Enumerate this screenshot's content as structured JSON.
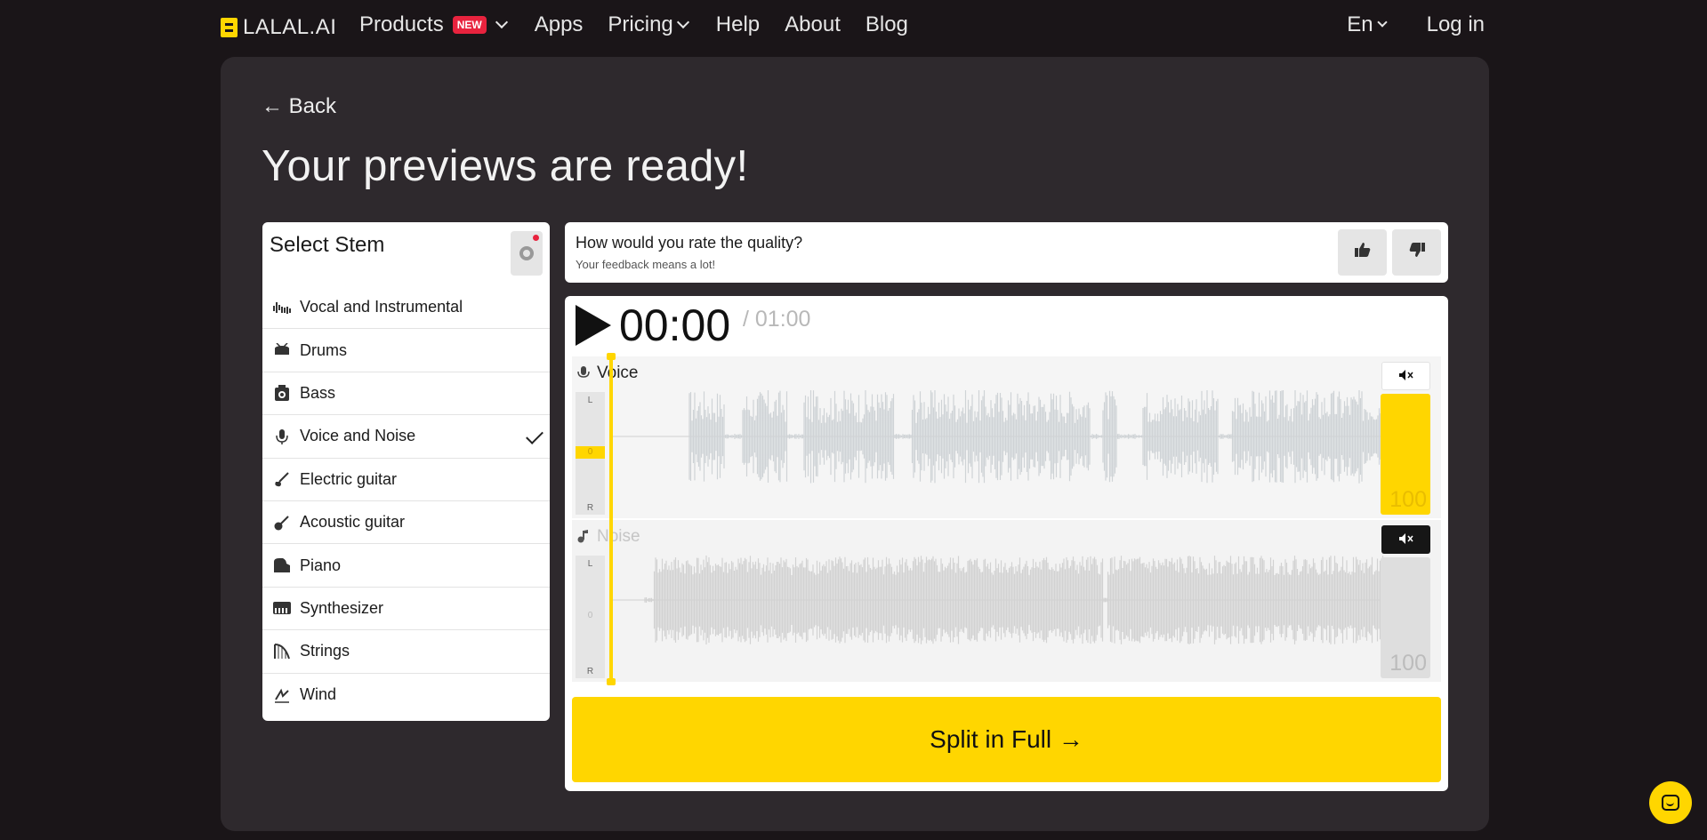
{
  "header": {
    "logo_text": "LALAL.AI",
    "nav": {
      "products": "Products",
      "products_badge": "NEW",
      "apps": "Apps",
      "pricing": "Pricing",
      "help": "Help",
      "about": "About",
      "blog": "Blog"
    },
    "language": "En",
    "login": "Log in"
  },
  "page": {
    "back_label": "← Back",
    "title": "Your previews are ready!"
  },
  "stems": {
    "heading": "Select Stem",
    "items": [
      {
        "label": "Vocal and Instrumental",
        "icon": "waveform-icon"
      },
      {
        "label": "Drums",
        "icon": "drum-icon"
      },
      {
        "label": "Bass",
        "icon": "bass-amp-icon"
      },
      {
        "label": "Voice and Noise",
        "icon": "microphone-icon",
        "selected": true
      },
      {
        "label": "Electric guitar",
        "icon": "electric-guitar-icon"
      },
      {
        "label": "Acoustic guitar",
        "icon": "acoustic-guitar-icon"
      },
      {
        "label": "Piano",
        "icon": "piano-icon"
      },
      {
        "label": "Synthesizer",
        "icon": "synthesizer-icon"
      },
      {
        "label": "Strings",
        "icon": "harp-icon"
      },
      {
        "label": "Wind",
        "icon": "wind-icon"
      }
    ]
  },
  "feedback": {
    "question": "How would you rate the quality?",
    "subtitle": "Your feedback means a lot!"
  },
  "player": {
    "current_time": "00:00",
    "total_time": "/ 01:00",
    "tracks": [
      {
        "name": "Voice",
        "pan_left": "L",
        "pan_mid": "0",
        "pan_right": "R",
        "volume": "100",
        "muted": false
      },
      {
        "name": "Noise",
        "pan_left": "L",
        "pan_mid": "0",
        "pan_right": "R",
        "volume": "100",
        "muted": true
      }
    ],
    "split_label": "Split in Full →"
  },
  "colors": {
    "accent": "#ffd600",
    "badge": "#e8233e",
    "background": "#1a1518",
    "card": "#2e292d"
  }
}
